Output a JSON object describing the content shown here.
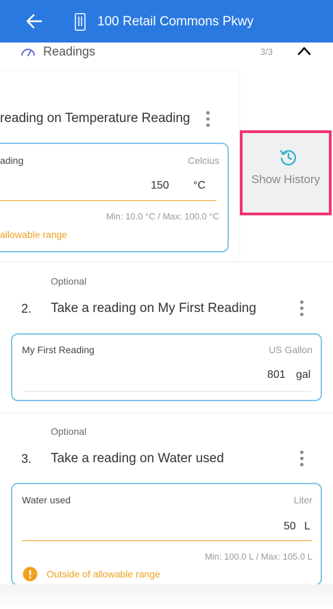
{
  "header": {
    "title": "100 Retail Commons Pkwy",
    "back_icon": "arrow-left-icon",
    "building_icon": "building-icon",
    "color": "#2a79e0"
  },
  "section": {
    "label": "Readings",
    "count": "3/3"
  },
  "item1": {
    "title": "reading on Temperature Reading",
    "field_name": "ading",
    "unit": "Celcius",
    "value": "150",
    "unit_abbr": "°C",
    "minmax": "Min: 10.0 °C / Max: 100.0 °C",
    "warning": "allowable range"
  },
  "history": {
    "label": "Show History",
    "border_color": "#f0346f"
  },
  "item2": {
    "optional": "Optional",
    "number": "2.",
    "title": "Take a reading on My First Reading",
    "field_name": "My First Reading",
    "unit": "US Gallon",
    "value": "801",
    "unit_abbr": "gal"
  },
  "item3": {
    "optional": "Optional",
    "number": "3.",
    "title": "Take a reading on Water used",
    "field_name": "Water used",
    "unit": "Liter",
    "value": "50",
    "unit_abbr": "L",
    "minmax": "Min: 100.0 L / Max: 105.0 L",
    "warning": "Outside of allowable range"
  },
  "colors": {
    "warning": "#f0a020",
    "card_border": "#7fc4ec"
  }
}
